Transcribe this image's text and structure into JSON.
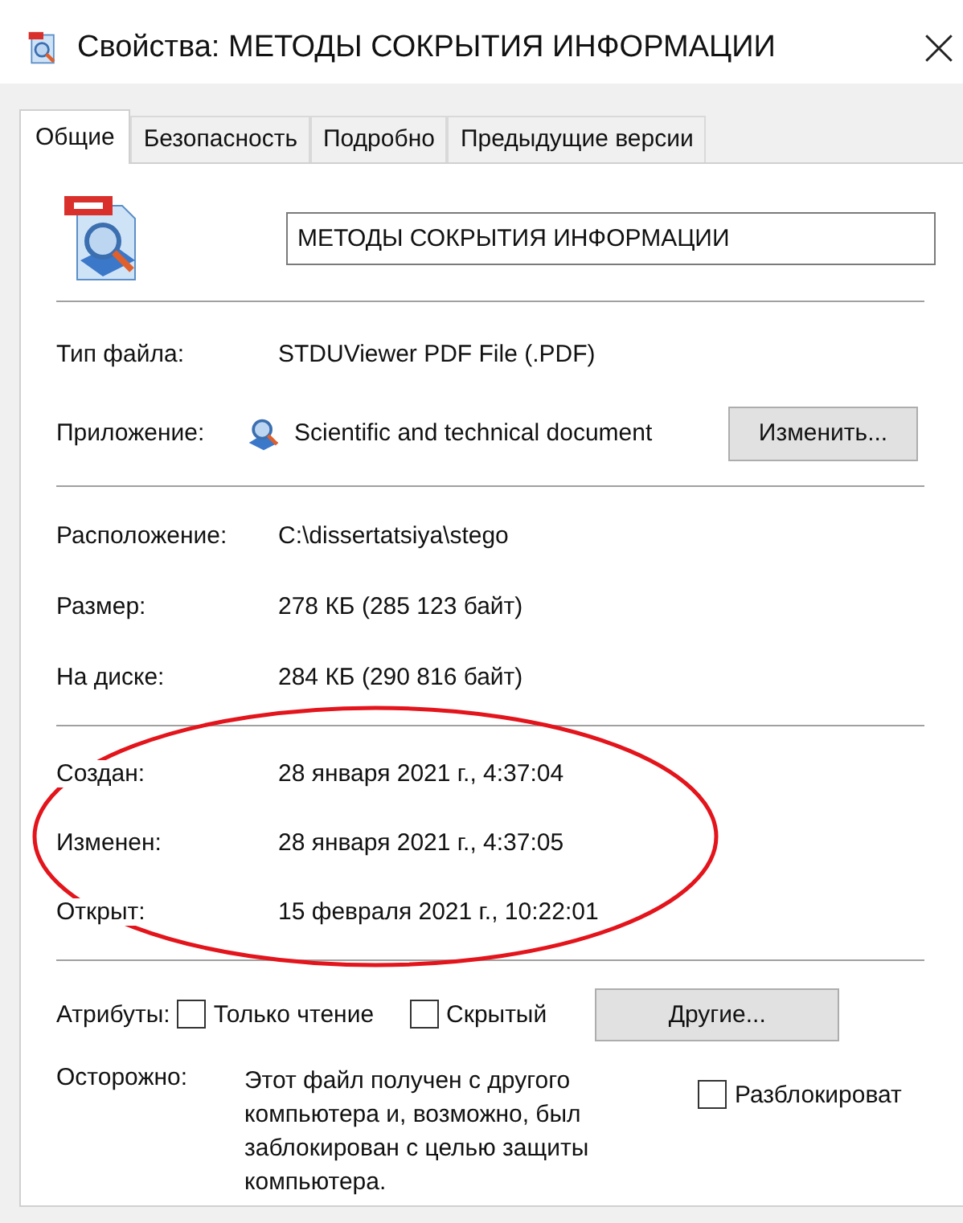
{
  "window": {
    "title": "Свойства: МЕТОДЫ СОКРЫТИЯ ИНФОРМАЦИИ"
  },
  "tabs": [
    {
      "label": "Общие",
      "selected": true
    },
    {
      "label": "Безопасность",
      "selected": false
    },
    {
      "label": "Подробно",
      "selected": false
    },
    {
      "label": "Предыдущие версии",
      "selected": false
    }
  ],
  "file_name": {
    "value": "МЕТОДЫ СОКРЫТИЯ ИНФОРМАЦИИ"
  },
  "type_info": [
    {
      "kind": "text",
      "label": "Тип файла:",
      "value": "STDUViewer PDF File (.PDF)"
    },
    {
      "kind": "app",
      "label": "Приложение:",
      "value": "Scientific and technical document",
      "button": "Изменить..."
    }
  ],
  "location_info": [
    {
      "label": "Расположение:",
      "value": "C:\\dissertatsiya\\stego"
    },
    {
      "label": "Размер:",
      "value": "278 КБ (285 123 байт)"
    },
    {
      "label": "На диске:",
      "value": "284 КБ (290 816 байт)"
    }
  ],
  "dates": [
    {
      "label": "Создан:",
      "value": "28 января 2021 г., 4:37:04"
    },
    {
      "label": "Изменен:",
      "value": "28 января 2021 г., 4:37:05"
    },
    {
      "label": "Открыт:",
      "value": "15 февраля 2021 г., 10:22:01"
    }
  ],
  "attributes": {
    "label": "Атрибуты:",
    "options": [
      {
        "label": "Только чтение",
        "checked": false
      },
      {
        "label": "Скрытый",
        "checked": false
      }
    ],
    "button": "Другие..."
  },
  "warning": {
    "label": "Осторожно:",
    "text": "Этот файл получен с другого\nкомпьютера и, возможно, был\nзаблокирован с целью защиты\nкомпьютера.",
    "unblock": {
      "label": "Разблокироват",
      "checked": false
    }
  }
}
